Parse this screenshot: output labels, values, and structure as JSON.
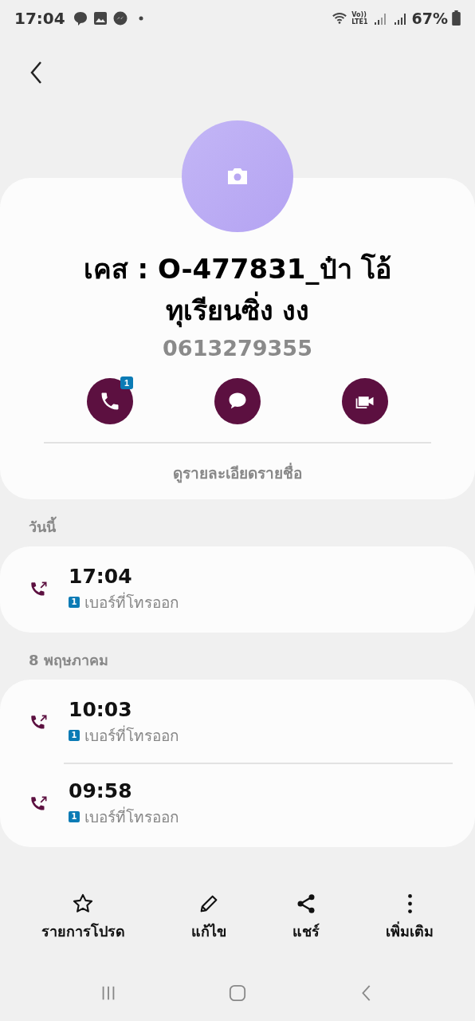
{
  "status_bar": {
    "time": "17:04",
    "volte": "Vo))",
    "network": "LTE1",
    "battery": "67%"
  },
  "contact": {
    "name": "เคส : O-477831_ป๋า โอ้ ทุเรียนซิ่ง งง",
    "phone": "0613279355",
    "call_badge": "1",
    "details_link": "ดูรายละเอียดรายชื่อ"
  },
  "call_groups": [
    {
      "date": "วันนี้",
      "calls": [
        {
          "time": "17:04",
          "sim": "1",
          "type": "เบอร์ที่โทรออก"
        }
      ]
    },
    {
      "date": "8 พฤษภาคม",
      "calls": [
        {
          "time": "10:03",
          "sim": "1",
          "type": "เบอร์ที่โทรออก"
        },
        {
          "time": "09:58",
          "sim": "1",
          "type": "เบอร์ที่โทรออก"
        }
      ]
    }
  ],
  "bottom_actions": [
    {
      "kind": "favorite",
      "label": "รายการโปรด"
    },
    {
      "kind": "edit",
      "label": "แก้ไข"
    },
    {
      "kind": "share",
      "label": "แชร์"
    },
    {
      "kind": "more",
      "label": "เพิ่มเติม"
    }
  ]
}
